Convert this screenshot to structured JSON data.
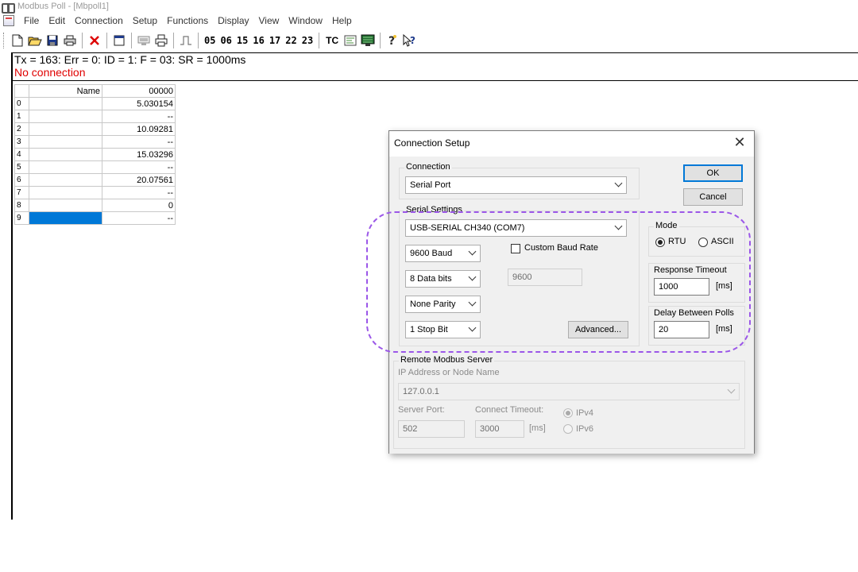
{
  "window": {
    "title": "Modbus Poll - [Mbpoll1]"
  },
  "menu": [
    "File",
    "Edit",
    "Connection",
    "Setup",
    "Functions",
    "Display",
    "View",
    "Window",
    "Help"
  ],
  "toolbar": {
    "icons": [
      "new-icon",
      "open-icon",
      "save-icon",
      "print-icon",
      "delete-icon",
      "window-icon",
      "read-write-icon",
      "printer-icon",
      "pulse-icon"
    ],
    "function_codes": [
      "05",
      "06",
      "15",
      "16",
      "17",
      "22",
      "23"
    ],
    "tc_label": "TC",
    "right_icons": [
      "comm-traffic-icon",
      "monitor-icon",
      "help-icon",
      "context-help-icon"
    ]
  },
  "status": {
    "line": "Tx = 163: Err = 0: ID = 1: F = 03: SR = 1000ms",
    "connection": "No connection",
    "connection_color": "#e00000"
  },
  "grid": {
    "headers": {
      "name": "Name",
      "address": "00000"
    },
    "rows": [
      {
        "index": "0",
        "name": "",
        "value": "5.030154"
      },
      {
        "index": "1",
        "name": "",
        "value": "--"
      },
      {
        "index": "2",
        "name": "",
        "value": "10.09281"
      },
      {
        "index": "3",
        "name": "",
        "value": "--"
      },
      {
        "index": "4",
        "name": "",
        "value": "15.03296"
      },
      {
        "index": "5",
        "name": "",
        "value": "--"
      },
      {
        "index": "6",
        "name": "",
        "value": "20.07561"
      },
      {
        "index": "7",
        "name": "",
        "value": "--"
      },
      {
        "index": "8",
        "name": "",
        "value": "0"
      },
      {
        "index": "9",
        "name": "",
        "value": "--"
      }
    ],
    "selected_color": "#0078d7"
  },
  "dialog": {
    "title": "Connection Setup",
    "connection": {
      "label": "Connection",
      "value": "Serial Port"
    },
    "ok_label": "OK",
    "cancel_label": "Cancel",
    "serial": {
      "label": "Serial Settings",
      "port": "USB-SERIAL CH340 (COM7)",
      "baud": "9600 Baud",
      "data_bits": "8 Data bits",
      "parity": "None Parity",
      "stop_bits": "1 Stop Bit",
      "custom_baud_label": "Custom Baud Rate",
      "custom_baud_value": "9600",
      "advanced_label": "Advanced..."
    },
    "mode": {
      "label": "Mode",
      "rtu": "RTU",
      "ascii": "ASCII"
    },
    "response_timeout": {
      "label": "Response Timeout",
      "value": "1000",
      "unit": "[ms]"
    },
    "delay_polls": {
      "label": "Delay Between Polls",
      "value": "20",
      "unit": "[ms]"
    },
    "remote": {
      "label": "Remote Modbus Server",
      "ip_label": "IP Address or Node Name",
      "ip_value": "127.0.0.1",
      "port_label": "Server Port:",
      "port_value": "502",
      "timeout_label": "Connect Timeout:",
      "timeout_value": "3000",
      "timeout_unit": "[ms]",
      "ipv4": "IPv4",
      "ipv6": "IPv6"
    }
  },
  "highlight_color": "#9b57e8"
}
